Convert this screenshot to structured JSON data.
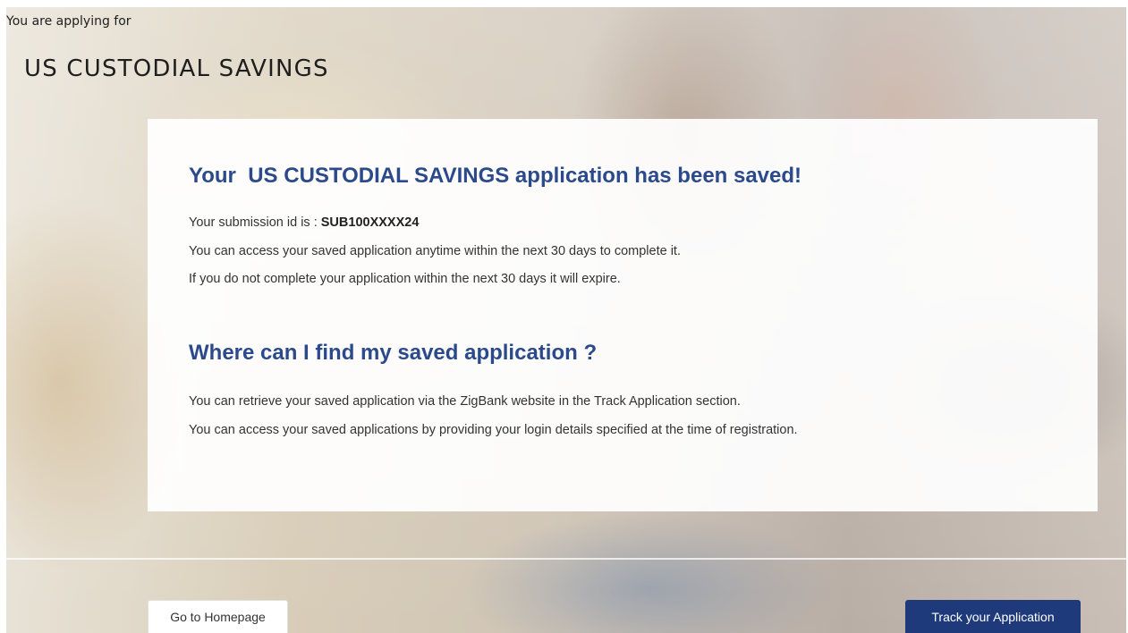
{
  "header": {
    "applying_label": "You are applying for",
    "product_title": "US CUSTODIAL SAVINGS"
  },
  "confirmation": {
    "heading": "Your  US CUSTODIAL SAVINGS application has been saved!",
    "submission_prefix": "Your submission id is : ",
    "submission_id": "SUB100XXXX24",
    "access_text": "You can access your saved application anytime within the next 30 days to complete it.",
    "expire_text": "If you do not complete your application within the next 30 days it will expire."
  },
  "help": {
    "heading": "Where can I find my saved application ?",
    "retrieve_text": "You can retrieve your saved application via the ZigBank website in the Track Application section.",
    "login_text": "You can access your saved applications by providing your login details specified at the time of registration."
  },
  "actions": {
    "homepage_label": "Go to Homepage",
    "track_label": "Track your Application"
  },
  "colors": {
    "heading": "#2b4a8b",
    "primary_button": "#1f3a7a"
  }
}
